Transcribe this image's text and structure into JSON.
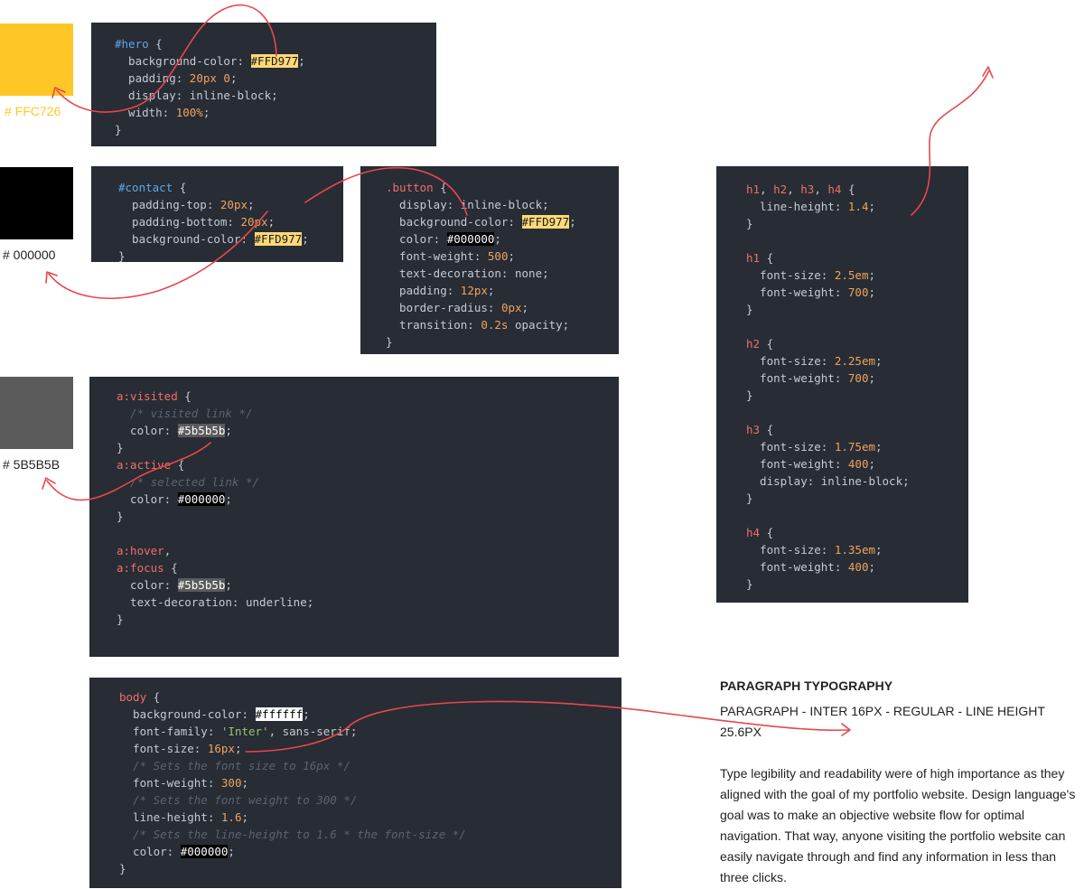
{
  "swatches": {
    "yellow": {
      "label": "# FFC726",
      "color": "#FFC726",
      "label_color": "#FFC726"
    },
    "black": {
      "label": "# 000000",
      "color": "#000000",
      "label_color": "#222222"
    },
    "grey": {
      "label": "# 5B5B5B",
      "color": "#5B5B5B",
      "label_color": "#222222"
    }
  },
  "code": {
    "hero": [
      [
        [
          "hsel",
          "#hero"
        ],
        [
          "kw",
          " {"
        ]
      ],
      [
        [
          "kw",
          "  background-color: "
        ],
        [
          "hl-yellow",
          "#FFD977"
        ],
        [
          "kw",
          ";"
        ]
      ],
      [
        [
          "kw",
          "  padding: "
        ],
        [
          "num",
          "20px 0"
        ],
        [
          "kw",
          ";"
        ]
      ],
      [
        [
          "kw",
          "  display: inline-block;"
        ]
      ],
      [
        [
          "kw",
          "  width: "
        ],
        [
          "num",
          "100%"
        ],
        [
          "kw",
          ";"
        ]
      ],
      [
        [
          "kw",
          "}"
        ]
      ]
    ],
    "contact": [
      [
        [
          "hsel",
          "#contact"
        ],
        [
          "kw",
          " {"
        ]
      ],
      [
        [
          "kw",
          "  padding-top: "
        ],
        [
          "num",
          "20px"
        ],
        [
          "kw",
          ";"
        ]
      ],
      [
        [
          "kw",
          "  padding-bottom: "
        ],
        [
          "num",
          "20px"
        ],
        [
          "kw",
          ";"
        ]
      ],
      [
        [
          "kw",
          "  background-color: "
        ],
        [
          "hl-yellow",
          "#FFD977"
        ],
        [
          "kw",
          ";"
        ]
      ],
      [
        [
          "kw",
          "}"
        ]
      ]
    ],
    "button": [
      [
        [
          "sel",
          ".button"
        ],
        [
          "kw",
          " {"
        ]
      ],
      [
        [
          "kw",
          "  display: inline-block;"
        ]
      ],
      [
        [
          "kw",
          "  background-color: "
        ],
        [
          "hl-yellow",
          "#FFD977"
        ],
        [
          "kw",
          ";"
        ]
      ],
      [
        [
          "kw",
          "  color: "
        ],
        [
          "hl-black",
          "#000000"
        ],
        [
          "kw",
          ";"
        ]
      ],
      [
        [
          "kw",
          "  font-weight: "
        ],
        [
          "num",
          "500"
        ],
        [
          "kw",
          ";"
        ]
      ],
      [
        [
          "kw",
          "  text-decoration: none;"
        ]
      ],
      [
        [
          "kw",
          "  padding: "
        ],
        [
          "num",
          "12px"
        ],
        [
          "kw",
          ";"
        ]
      ],
      [
        [
          "kw",
          "  border-radius: "
        ],
        [
          "num",
          "0px"
        ],
        [
          "kw",
          ";"
        ]
      ],
      [
        [
          "kw",
          "  transition: "
        ],
        [
          "num",
          "0.2s"
        ],
        [
          "kw",
          " opacity;"
        ]
      ],
      [
        [
          "kw",
          "}"
        ]
      ]
    ],
    "links": [
      [
        [
          "sel",
          "a:visited"
        ],
        [
          "kw",
          " {"
        ]
      ],
      [
        [
          "cm",
          "  /* visited link */"
        ]
      ],
      [
        [
          "kw",
          "  color: "
        ],
        [
          "hl-grey",
          "#5b5b5b"
        ],
        [
          "kw",
          ";"
        ]
      ],
      [
        [
          "kw",
          "}"
        ]
      ],
      [
        [
          "sel",
          "a:active"
        ],
        [
          "kw",
          " {"
        ]
      ],
      [
        [
          "cm",
          "  /* selected link */"
        ]
      ],
      [
        [
          "kw",
          "  color: "
        ],
        [
          "hl-black",
          "#000000"
        ],
        [
          "kw",
          ";"
        ]
      ],
      [
        [
          "kw",
          "}"
        ]
      ],
      [
        [
          "kw",
          ""
        ]
      ],
      [
        [
          "sel",
          "a:hover"
        ],
        [
          "kw",
          ","
        ]
      ],
      [
        [
          "sel",
          "a:focus"
        ],
        [
          "kw",
          " {"
        ]
      ],
      [
        [
          "kw",
          "  color: "
        ],
        [
          "hl-grey",
          "#5b5b5b"
        ],
        [
          "kw",
          ";"
        ]
      ],
      [
        [
          "kw",
          "  text-decoration: underline;"
        ]
      ],
      [
        [
          "kw",
          "}"
        ]
      ]
    ],
    "body": [
      [
        [
          "sel",
          "body"
        ],
        [
          "kw",
          " {"
        ]
      ],
      [
        [
          "kw",
          "  background-color: "
        ],
        [
          "hl-white",
          "#ffffff"
        ],
        [
          "kw",
          ";"
        ]
      ],
      [
        [
          "kw",
          "  font-family: "
        ],
        [
          "str",
          "'Inter'"
        ],
        [
          "kw",
          ", sans-serif;"
        ]
      ],
      [
        [
          "kw",
          "  font-size: "
        ],
        [
          "num",
          "16px"
        ],
        [
          "kw",
          ";"
        ]
      ],
      [
        [
          "cm",
          "  /* Sets the font size to 16px */"
        ]
      ],
      [
        [
          "kw",
          "  font-weight: "
        ],
        [
          "num",
          "300"
        ],
        [
          "kw",
          ";"
        ]
      ],
      [
        [
          "cm",
          "  /* Sets the font weight to 300 */"
        ]
      ],
      [
        [
          "kw",
          "  line-height: "
        ],
        [
          "num",
          "1.6"
        ],
        [
          "kw",
          ";"
        ]
      ],
      [
        [
          "cm",
          "  /* Sets the line-height to 1.6 * the font-size */"
        ]
      ],
      [
        [
          "kw",
          "  color: "
        ],
        [
          "hl-black",
          "#000000"
        ],
        [
          "kw",
          ";"
        ]
      ],
      [
        [
          "kw",
          "}"
        ]
      ]
    ],
    "headings": [
      [
        [
          "sel",
          "h1"
        ],
        [
          "kw",
          ", "
        ],
        [
          "sel",
          "h2"
        ],
        [
          "kw",
          ", "
        ],
        [
          "sel",
          "h3"
        ],
        [
          "kw",
          ", "
        ],
        [
          "sel",
          "h4"
        ],
        [
          "kw",
          " {"
        ]
      ],
      [
        [
          "kw",
          "  line-height: "
        ],
        [
          "num",
          "1.4"
        ],
        [
          "kw",
          ";"
        ]
      ],
      [
        [
          "kw",
          "}"
        ]
      ],
      [
        [
          "kw",
          ""
        ]
      ],
      [
        [
          "sel",
          "h1"
        ],
        [
          "kw",
          " {"
        ]
      ],
      [
        [
          "kw",
          "  font-size: "
        ],
        [
          "num",
          "2.5em"
        ],
        [
          "kw",
          ";"
        ]
      ],
      [
        [
          "kw",
          "  font-weight: "
        ],
        [
          "num",
          "700"
        ],
        [
          "kw",
          ";"
        ]
      ],
      [
        [
          "kw",
          "}"
        ]
      ],
      [
        [
          "kw",
          ""
        ]
      ],
      [
        [
          "sel",
          "h2"
        ],
        [
          "kw",
          " {"
        ]
      ],
      [
        [
          "kw",
          "  font-size: "
        ],
        [
          "num",
          "2.25em"
        ],
        [
          "kw",
          ";"
        ]
      ],
      [
        [
          "kw",
          "  font-weight: "
        ],
        [
          "num",
          "700"
        ],
        [
          "kw",
          ";"
        ]
      ],
      [
        [
          "kw",
          "}"
        ]
      ],
      [
        [
          "kw",
          ""
        ]
      ],
      [
        [
          "sel",
          "h3"
        ],
        [
          "kw",
          " {"
        ]
      ],
      [
        [
          "kw",
          "  font-size: "
        ],
        [
          "num",
          "1.75em"
        ],
        [
          "kw",
          ";"
        ]
      ],
      [
        [
          "kw",
          "  font-weight: "
        ],
        [
          "num",
          "400"
        ],
        [
          "kw",
          ";"
        ]
      ],
      [
        [
          "kw",
          "  display: inline-block;"
        ]
      ],
      [
        [
          "kw",
          "}"
        ]
      ],
      [
        [
          "kw",
          ""
        ]
      ],
      [
        [
          "sel",
          "h4"
        ],
        [
          "kw",
          " {"
        ]
      ],
      [
        [
          "kw",
          "  font-size: "
        ],
        [
          "num",
          "1.35em"
        ],
        [
          "kw",
          ";"
        ]
      ],
      [
        [
          "kw",
          "  font-weight: "
        ],
        [
          "num",
          "400"
        ],
        [
          "kw",
          ";"
        ]
      ],
      [
        [
          "kw",
          "}"
        ]
      ]
    ]
  },
  "typography": {
    "title": "PARAGRAPH TYPOGRAPHY",
    "spec": "PARAGRAPH - INTER 16PX - REGULAR - LINE HEIGHT 25.6PX",
    "body": "Type legibility and readability were of high importance as they aligned with the goal of my portfolio website. Design language's goal was to make an objective website flow for optimal navigation. That way, anyone visiting the portfolio website can easily navigate through and find any information in less than three clicks."
  },
  "colors": {
    "arrow": "#E8474C",
    "code_bg": "#282c34"
  }
}
